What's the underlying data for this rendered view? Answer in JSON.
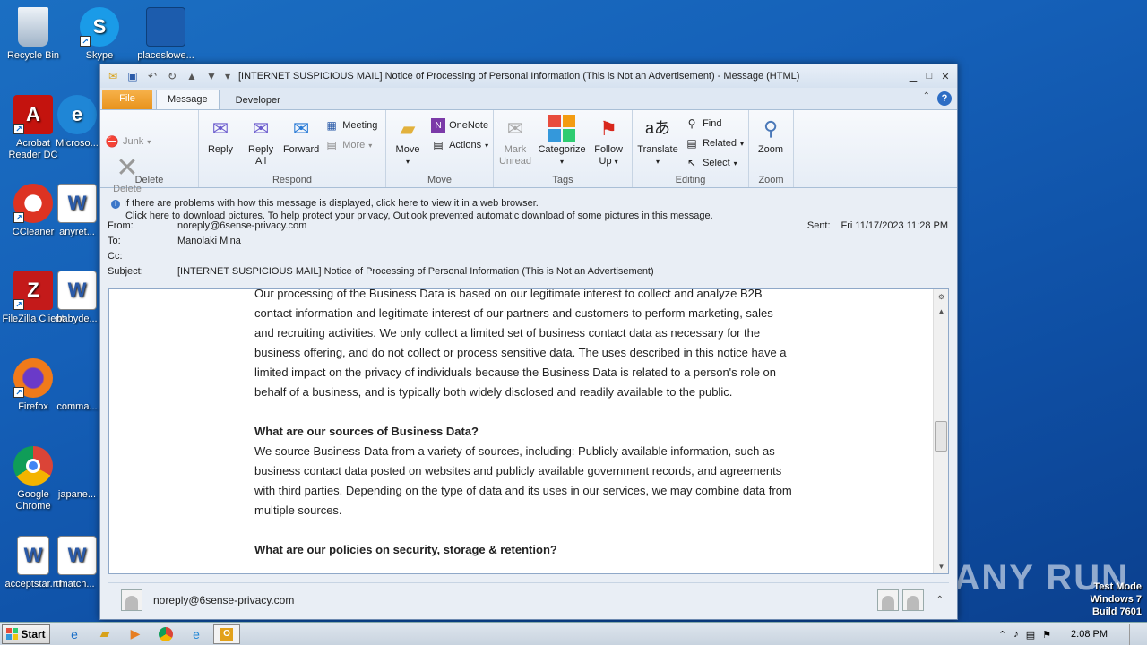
{
  "desktop": {
    "icons": [
      {
        "label": "Recycle Bin",
        "name": "recycle-bin-icon"
      },
      {
        "label": "Skype",
        "name": "skype-icon"
      },
      {
        "label": "placeslowe...",
        "name": "file-icon"
      },
      {
        "label": "Acrobat Reader DC",
        "name": "acrobat-icon"
      },
      {
        "label": "Microso...",
        "name": "edge-icon"
      },
      {
        "label": "CCleaner",
        "name": "ccleaner-icon"
      },
      {
        "label": "anyret...",
        "name": "word-doc-icon"
      },
      {
        "label": "FileZilla Client",
        "name": "filezilla-icon"
      },
      {
        "label": "babyde...",
        "name": "word-doc-icon"
      },
      {
        "label": "Firefox",
        "name": "firefox-icon"
      },
      {
        "label": "comma...",
        "name": "file-icon"
      },
      {
        "label": "Google Chrome",
        "name": "chrome-icon"
      },
      {
        "label": "japane...",
        "name": "file-icon"
      },
      {
        "label": "acceptstar.rtf",
        "name": "word-doc-icon"
      },
      {
        "label": "match...",
        "name": "word-doc-icon"
      }
    ]
  },
  "window": {
    "title": "[INTERNET SUSPICIOUS MAIL] Notice of Processing of Personal Information (This is Not an Advertisement)  -  Message (HTML)"
  },
  "tabs": {
    "file": "File",
    "message": "Message",
    "developer": "Developer"
  },
  "ribbon": {
    "delete_group": {
      "label": "Delete",
      "junk": "Junk",
      "delete": "Delete"
    },
    "respond_group": {
      "label": "Respond",
      "reply": "Reply",
      "reply_all_1": "Reply",
      "reply_all_2": "All",
      "forward": "Forward",
      "meeting": "Meeting",
      "more": "More"
    },
    "move_group": {
      "label": "Move",
      "move": "Move",
      "onenote": "OneNote",
      "actions": "Actions"
    },
    "tags_group": {
      "label": "Tags",
      "mark_unread_1": "Mark",
      "mark_unread_2": "Unread",
      "categorize": "Categorize",
      "follow_up_1": "Follow",
      "follow_up_2": "Up"
    },
    "editing_group": {
      "label": "Editing",
      "translate": "Translate",
      "find": "Find",
      "related": "Related",
      "select": "Select"
    },
    "zoom_group": {
      "label": "Zoom",
      "zoom": "Zoom"
    }
  },
  "infobar": {
    "line1": "If there are problems with how this message is displayed, click here to view it in a web browser.",
    "line2": "Click here to download pictures. To help protect your privacy, Outlook prevented automatic download of some pictures in this message."
  },
  "header": {
    "from_label": "From:",
    "from_value": "noreply@6sense-privacy.com",
    "to_label": "To:",
    "to_value": "Manolaki Mina",
    "cc_label": "Cc:",
    "cc_value": "",
    "subject_label": "Subject:",
    "subject_value": "[INTERNET SUSPICIOUS MAIL] Notice of Processing of Personal Information (This is Not an Advertisement)",
    "sent_label": "Sent:",
    "sent_value": "Fri 11/17/2023 11:28 PM"
  },
  "body": {
    "para1": "Our processing of the Business Data is based on our legitimate interest to collect and analyze B2B contact information and legitimate interest of our partners and customers to perform marketing, sales and recruiting activities. We only collect a limited set of business contact data as necessary for the business offering, and do not collect or process sensitive data. The uses described in this notice have a limited impact on the privacy of individuals because the Business Data is related to a person's role on behalf of a business, and is typically both widely disclosed and readily available to the public.",
    "heading2": "What are our sources of Business Data?",
    "para2": "We source Business Data from a variety of sources, including: Publicly available information, such as business contact data posted on websites and publicly available government records, and agreements with third parties. Depending on the type of data and its uses in our services, we may combine data from multiple sources.",
    "heading3": "What are our policies on security, storage & retention?"
  },
  "people_pane": {
    "sender": "noreply@6sense-privacy.com"
  },
  "taskbar": {
    "start": "Start",
    "clock": "2:08 PM"
  },
  "watermark": {
    "line1": "Test Mode",
    "line2": "Windows 7",
    "line3": "Build 7601",
    "brand": "ANY RUN"
  }
}
